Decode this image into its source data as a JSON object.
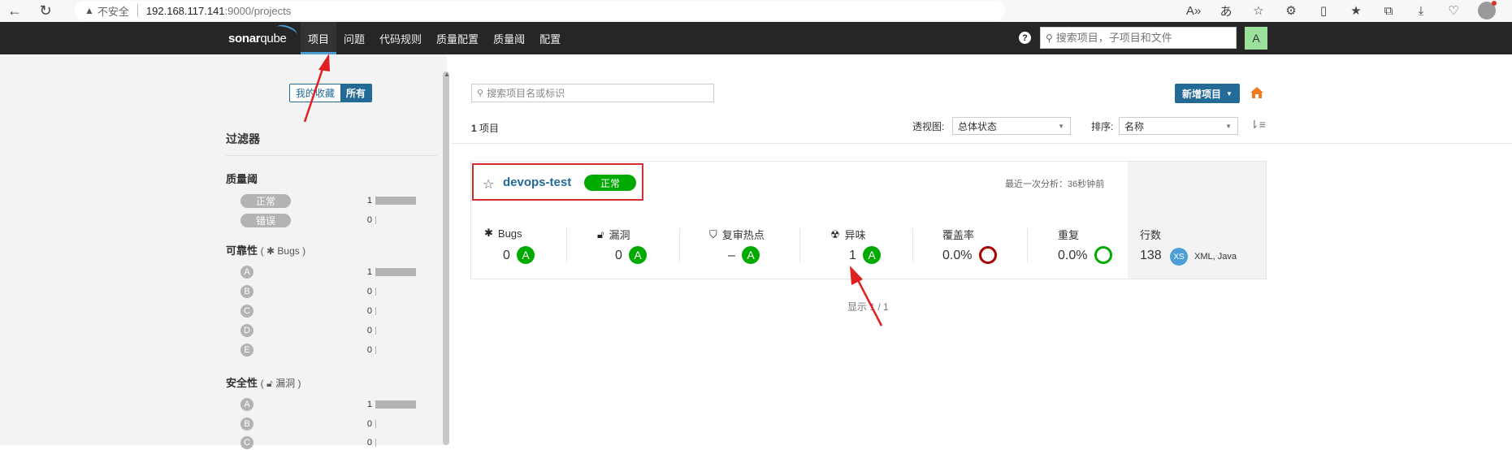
{
  "browser": {
    "security_label": "不安全",
    "url_host": "192.168.117.141",
    "url_path": ":9000/projects"
  },
  "navbar": {
    "logo_bold": "sonar",
    "logo_light": "qube",
    "items": [
      {
        "label": "项目",
        "active": true
      },
      {
        "label": "问题"
      },
      {
        "label": "代码规则"
      },
      {
        "label": "质量配置"
      },
      {
        "label": "质量阈"
      },
      {
        "label": "配置"
      }
    ],
    "search_placeholder": "搜索项目，子项目和文件",
    "user_initial": "A"
  },
  "sidebar": {
    "toggle_favorites": "我的收藏",
    "toggle_all": "所有",
    "filters_title": "过滤器",
    "quality_gate": {
      "title": "质量阈",
      "rows": [
        {
          "label": "正常",
          "count": "1",
          "fraction": 1
        },
        {
          "label": "错误",
          "count": "0",
          "fraction": 0
        }
      ]
    },
    "reliability": {
      "title": "可靠性",
      "sub": "Bugs",
      "rows": [
        {
          "label": "A",
          "count": "1",
          "fraction": 1
        },
        {
          "label": "B",
          "count": "0",
          "fraction": 0
        },
        {
          "label": "C",
          "count": "0",
          "fraction": 0
        },
        {
          "label": "D",
          "count": "0",
          "fraction": 0
        },
        {
          "label": "E",
          "count": "0",
          "fraction": 0
        }
      ]
    },
    "security": {
      "title": "安全性",
      "sub": "漏洞",
      "rows": [
        {
          "label": "A",
          "count": "1",
          "fraction": 1
        },
        {
          "label": "B",
          "count": "0",
          "fraction": 0
        },
        {
          "label": "C",
          "count": "0",
          "fraction": 0
        }
      ]
    }
  },
  "main": {
    "search_placeholder": "搜索项目名或标识",
    "new_project_label": "新增项目",
    "project_count": "1",
    "project_count_suffix": "项目",
    "perspective_label": "透视图:",
    "perspective_value": "总体状态",
    "sort_label": "排序:",
    "sort_value": "名称",
    "pagination": "显示 1 / 1"
  },
  "project": {
    "name": "devops-test",
    "quality_gate": "正常",
    "last_analysis": "最近一次分析：36秒钟前",
    "measures": {
      "bugs_label": "Bugs",
      "bugs_value": "0",
      "bugs_rating": "A",
      "vuln_label": "漏洞",
      "vuln_value": "0",
      "vuln_rating": "A",
      "hotspots_label": "复审热点",
      "hotspots_value": "–",
      "hotspots_rating": "A",
      "smells_label": "异味",
      "smells_value": "1",
      "smells_rating": "A",
      "coverage_label": "覆盖率",
      "coverage_value": "0.0%",
      "dup_label": "重复",
      "dup_value": "0.0%",
      "lines_label": "行数",
      "lines_value": "138",
      "size_rating": "XS",
      "languages": "XML, Java"
    }
  },
  "colors": {
    "brand": "#236a97",
    "ok": "#00aa00",
    "annotation": "#d02f2f"
  }
}
